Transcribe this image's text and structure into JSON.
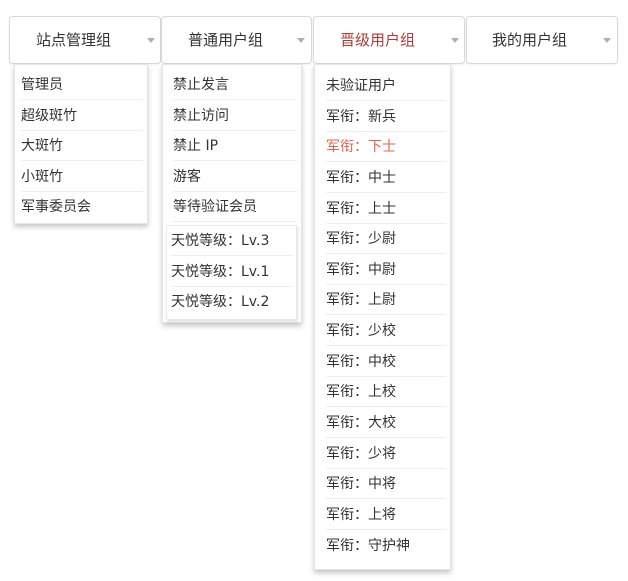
{
  "tabs": [
    {
      "label": "站点管理组"
    },
    {
      "label": "普通用户组"
    },
    {
      "label": "晋级用户组"
    },
    {
      "label": "我的用户组"
    }
  ],
  "active_tab_color": "#b03a3a",
  "selected_item_color": "#e0634f",
  "menus": {
    "admin": [
      "管理员",
      "超级斑竹",
      "大斑竹",
      "小斑竹",
      "军事委员会"
    ],
    "normal": [
      "禁止发言",
      "禁止访问",
      "禁止 IP",
      "游客",
      "等待验证会员"
    ],
    "normal_levels": [
      "天悦等级：Lv.3",
      "天悦等级：Lv.1",
      "天悦等级：Lv.2"
    ],
    "promoted": [
      "未验证用户",
      "军衔：新兵",
      "军衔：下士",
      "军衔：中士",
      "军衔：上士",
      "军衔：少尉",
      "军衔：中尉",
      "军衔：上尉",
      "军衔：少校",
      "军衔：中校",
      "军衔：上校",
      "军衔：大校",
      "军衔：少将",
      "军衔：中将",
      "军衔：上将",
      "军衔：守护神"
    ]
  },
  "promoted_selected": "军衔：下士"
}
